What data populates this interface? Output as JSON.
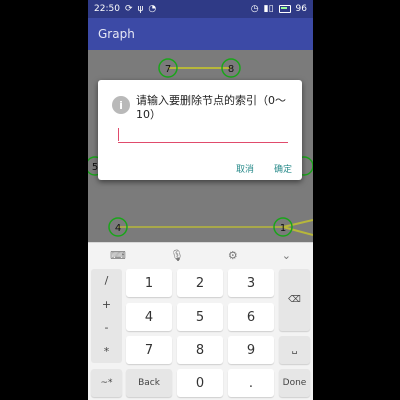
{
  "status_bar": {
    "time": "22:50",
    "left_icons": [
      "sync-icon",
      "usb-icon",
      "notification-icon"
    ],
    "right_icons": [
      "alarm-icon",
      "signal-icon",
      "battery-icon"
    ],
    "battery_percent": "96"
  },
  "app_bar": {
    "title": "Graph"
  },
  "graph": {
    "node_labels": [
      "7",
      "8",
      "5",
      "4",
      "1"
    ]
  },
  "dialog": {
    "message": "请输入要删除节点的索引（0～10）",
    "input_value": "",
    "cancel_label": "取消",
    "ok_label": "确定"
  },
  "keyboard": {
    "toolbar_icons": [
      "keyboard-icon",
      "mic-icon",
      "settings-icon",
      "collapse-icon"
    ],
    "symbols": [
      "/",
      "+",
      "-",
      "*"
    ],
    "digits": [
      "1",
      "2",
      "3",
      "4",
      "5",
      "6",
      "7",
      "8",
      "9",
      "0"
    ],
    "back_label": "Back",
    "done_label": "Done",
    "switch_label": "~*",
    "dot_label": "."
  },
  "colors": {
    "status_bar": "#2f3a86",
    "app_bar": "#3c4aa6",
    "accent": "#e04b6c",
    "dialog_button": "#2a8b8b",
    "node_stroke": "#1aa51a"
  }
}
